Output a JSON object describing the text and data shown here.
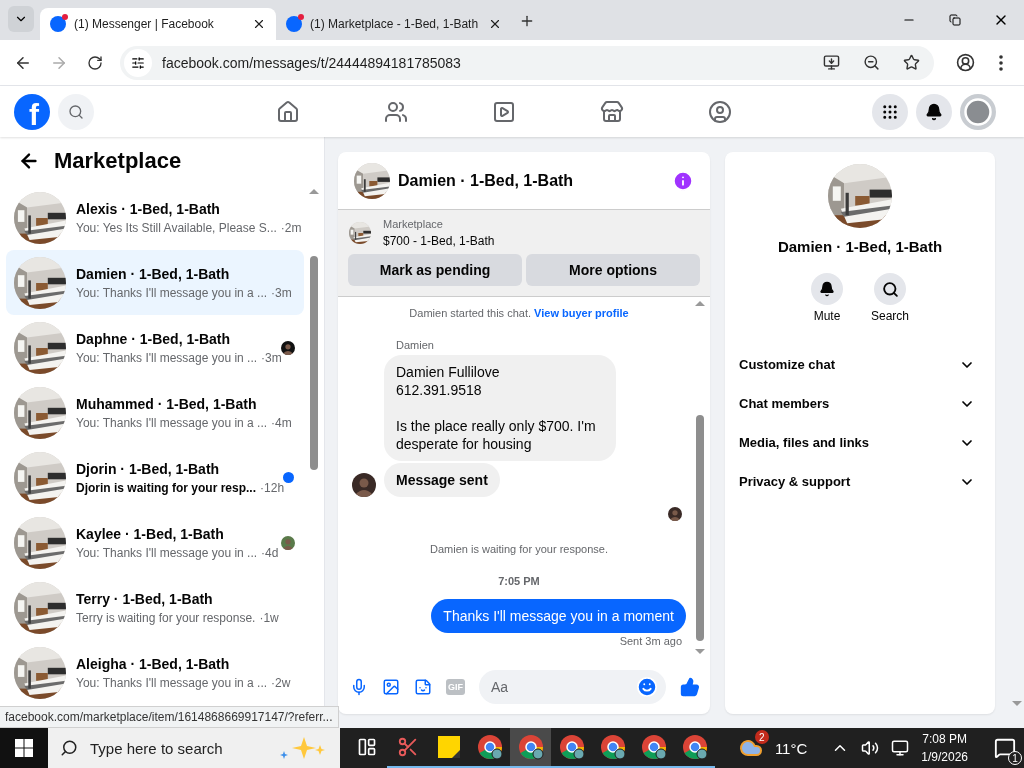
{
  "browser": {
    "tabs": [
      {
        "title": "(1) Messenger | Facebook",
        "selected": true
      },
      {
        "title": "(1) Marketplace - 1-Bed, 1-Bath",
        "selected": false
      }
    ],
    "url": "facebook.com/messages/t/24444894181785083",
    "status_url": "facebook.com/marketplace/item/1614868669917147/?referr..."
  },
  "nav": {
    "logo": "f"
  },
  "sidebar": {
    "title": "Marketplace",
    "conversations": [
      {
        "name": "Alexis · 1-Bed, 1-Bath",
        "preview": "You: Yes Its Still Available, Please S...",
        "time": "·2m",
        "selected": false,
        "unread": false,
        "seen": false
      },
      {
        "name": "Damien · 1-Bed, 1-Bath",
        "preview": "You: Thanks I'll message you in a ...",
        "time": "·3m",
        "selected": true,
        "unread": false,
        "seen": false
      },
      {
        "name": "Daphne · 1-Bed, 1-Bath",
        "preview": "You: Thanks I'll message you in ...",
        "time": "·3m",
        "selected": false,
        "unread": false,
        "seen": true
      },
      {
        "name": "Muhammed · 1-Bed, 1-Bath",
        "preview": "You: Thanks I'll message you in a ...",
        "time": "·4m",
        "selected": false,
        "unread": false,
        "seen": false
      },
      {
        "name": "Djorin · 1-Bed, 1-Bath",
        "preview": "Djorin is waiting for your resp...",
        "time": "·12h",
        "selected": false,
        "unread": true,
        "seen": false
      },
      {
        "name": "Kaylee · 1-Bed, 1-Bath",
        "preview": "You: Thanks I'll message you in ...",
        "time": "·4d",
        "selected": false,
        "unread": false,
        "seen": true
      },
      {
        "name": "Terry · 1-Bed, 1-Bath",
        "preview": "Terry is waiting for your response.",
        "time": "·1w",
        "selected": false,
        "unread": false,
        "seen": false
      },
      {
        "name": "Aleigha · 1-Bed, 1-Bath",
        "preview": "You: Thanks I'll message you in a ...",
        "time": "·2w",
        "selected": false,
        "unread": false,
        "seen": false
      }
    ]
  },
  "chat": {
    "title": "Damien · 1-Bed, 1-Bath",
    "listing": {
      "source": "Marketplace",
      "summary": "$700 - 1-Bed, 1-Bath"
    },
    "actions": [
      "Mark as pending",
      "More options"
    ],
    "messages": [
      {
        "kind": "system",
        "text": "Damien started this chat.",
        "link": "View buyer profile"
      },
      {
        "kind": "sender",
        "text": "Damien"
      },
      {
        "kind": "incoming",
        "paragraphs": [
          "Damien Fullilove\n612.391.9518",
          "Is the place really only $700. I'm desperate for housing"
        ],
        "bold": false,
        "avatar": false
      },
      {
        "kind": "incoming",
        "paragraphs": [
          "Message sent"
        ],
        "bold": true,
        "avatar": true
      },
      {
        "kind": "read_receipt"
      },
      {
        "kind": "system",
        "text": "Damien is waiting for your response."
      },
      {
        "kind": "timestamp",
        "text": "7:05 PM"
      },
      {
        "kind": "outgoing",
        "text": "Thanks I'll message you in a moment"
      },
      {
        "kind": "status",
        "text": "Sent 3m ago"
      }
    ],
    "composer": {
      "placeholder": "Aa",
      "gif": "GIF"
    }
  },
  "details": {
    "title": "Damien · 1-Bed, 1-Bath",
    "actions": [
      {
        "kind": "mute",
        "label": "Mute"
      },
      {
        "kind": "search",
        "label": "Search"
      }
    ],
    "sections": [
      {
        "label": "Customize chat",
        "expanded": false
      },
      {
        "label": "Chat members",
        "expanded": false
      },
      {
        "label": "Media, files and links",
        "expanded": false
      },
      {
        "label": "Privacy & support",
        "expanded": false
      }
    ]
  },
  "taskbar": {
    "search_placeholder": "Type here to search",
    "apps": [
      {
        "kind": "task-view",
        "selected": false
      },
      {
        "kind": "snip",
        "selected": false
      },
      {
        "kind": "notes",
        "selected": false
      },
      {
        "kind": "browser",
        "selected": false
      },
      {
        "kind": "browser",
        "selected": true
      },
      {
        "kind": "browser",
        "selected": false
      },
      {
        "kind": "browser",
        "selected": false
      },
      {
        "kind": "browser",
        "selected": false
      },
      {
        "kind": "browser",
        "selected": false
      }
    ],
    "weather": {
      "temperature": "11°C",
      "badge": "2"
    },
    "time": "7:08 PM",
    "date": "1/9/2026",
    "notifications": "1"
  }
}
